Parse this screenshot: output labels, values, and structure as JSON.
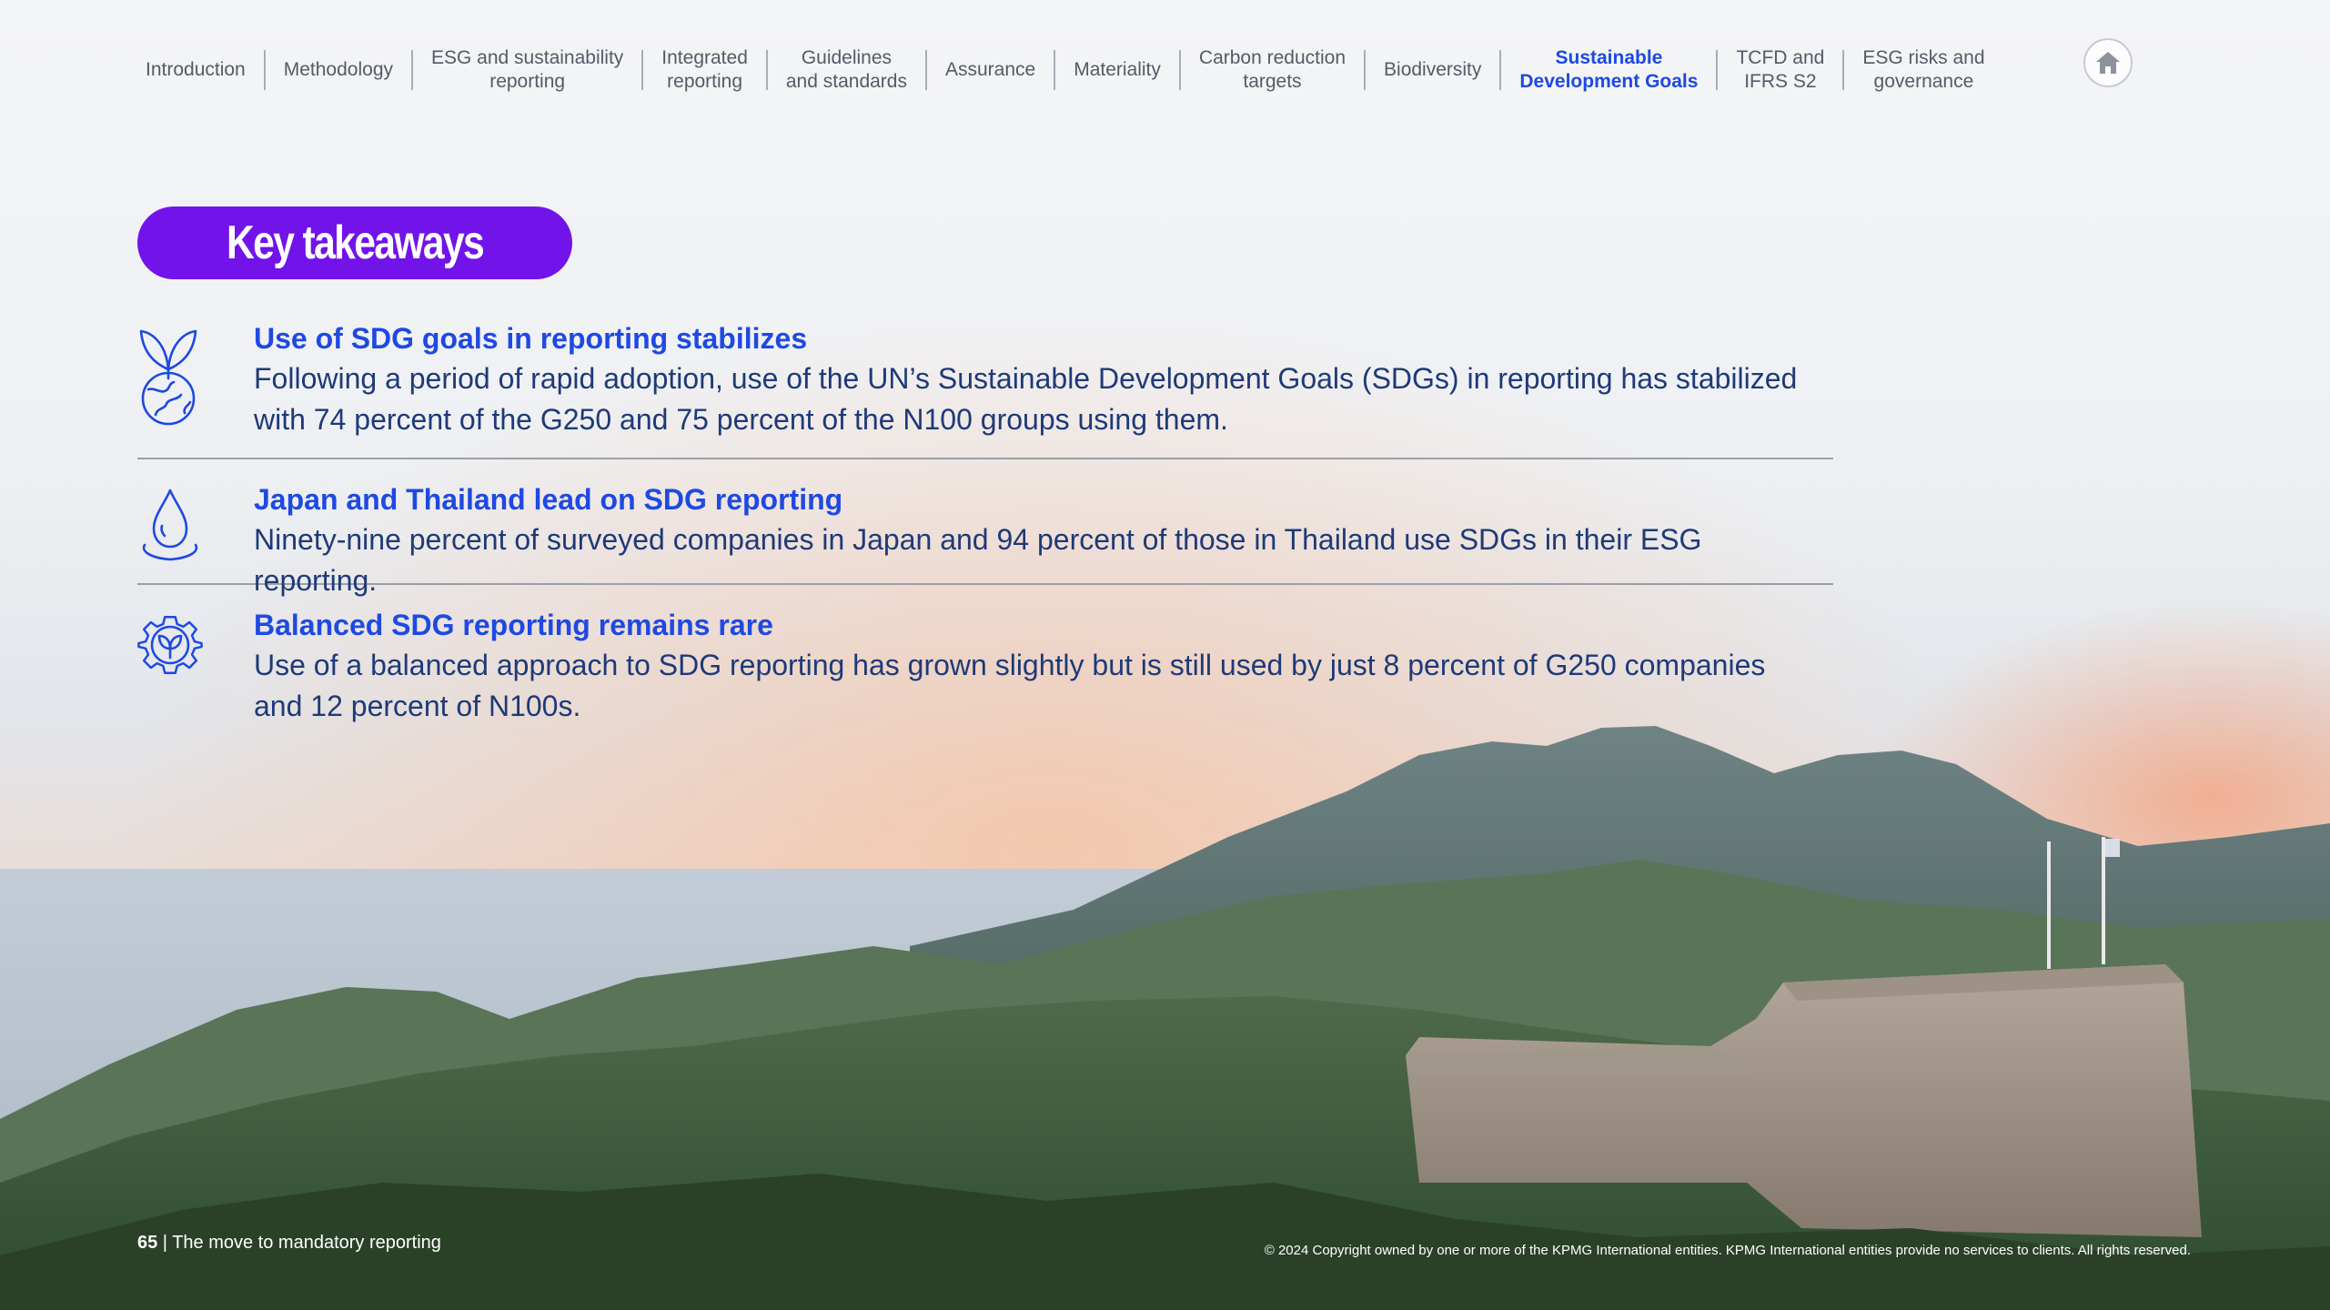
{
  "nav": {
    "items": [
      "Introduction",
      "Methodology",
      "ESG and sustainability\nreporting",
      "Integrated\nreporting",
      "Guidelines\nand standards",
      "Assurance",
      "Materiality",
      "Carbon reduction\ntargets",
      "Biodiversity",
      "Sustainable\nDevelopment Goals",
      "TCFD and\nIFRS S2",
      "ESG risks and\ngovernance"
    ],
    "active_index": 9,
    "home_icon": "home-icon"
  },
  "title": "Key takeaways",
  "takeaways": [
    {
      "icon": "plant-globe-icon",
      "heading": "Use of SDG goals in reporting stabilizes",
      "body": "Following a period of rapid adoption, use of the UN’s Sustainable Development Goals (SDGs) in reporting has stabilized with 74 percent of the G250 and 75 percent of the N100 groups using them."
    },
    {
      "icon": "water-drop-icon",
      "heading": "Japan and Thailand lead on SDG reporting",
      "body": "Ninety-nine percent of surveyed companies in Japan and 94 percent of those in Thailand use SDGs in their ESG reporting."
    },
    {
      "icon": "gear-leaf-icon",
      "heading": "Balanced SDG reporting remains rare",
      "body": "Use of a balanced approach to SDG reporting has grown slightly but is still used by just 8 percent of G250 companies and 12 percent of N100s."
    }
  ],
  "footer": {
    "page_number": "65",
    "section": "The move to mandatory reporting",
    "copyright": "© 2024 Copyright owned by one or more of the KPMG International entities. KPMG International entities provide no services to clients. All rights reserved."
  },
  "colors": {
    "accent_purple": "#7213ea",
    "heading_blue": "#1e49e2",
    "body_navy": "#1e3a78"
  }
}
